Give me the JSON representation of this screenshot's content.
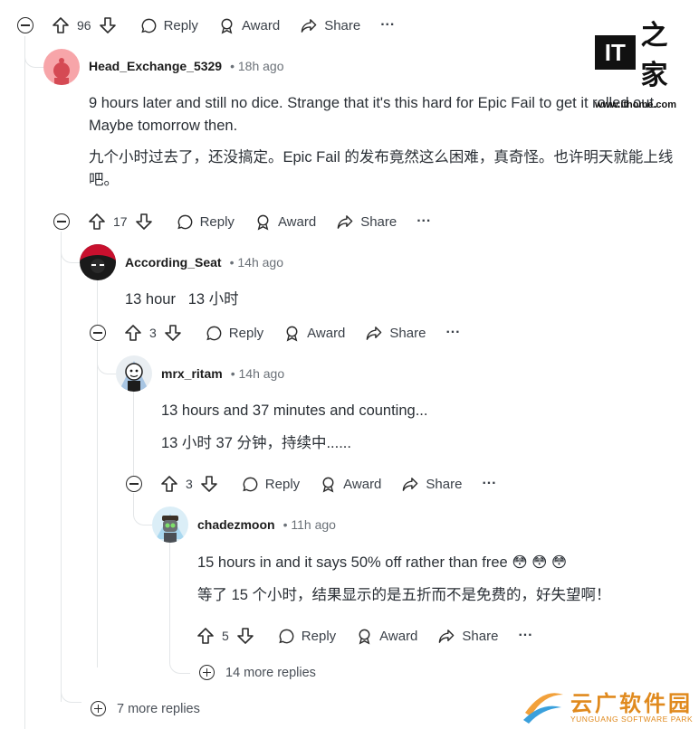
{
  "actions": {
    "reply": "Reply",
    "award": "Award",
    "share": "Share",
    "more": "···"
  },
  "top": {
    "votes": "96"
  },
  "comments": [
    {
      "user": "Head_Exchange_5329",
      "time": "18h ago",
      "votes": "17",
      "lines": [
        "9 hours later and still no dice. Strange that it's this hard for Epic Fail to get it rolled out. Maybe tomorrow then.",
        "九个小时过去了，还没搞定。Epic Fail 的发布竟然这么困难，真奇怪。也许明天就能上线吧。"
      ]
    },
    {
      "user": "According_Seat",
      "time": "14h ago",
      "votes": "3",
      "lines": [
        "13 hour   13 小时"
      ]
    },
    {
      "user": "mrx_ritam",
      "time": "14h ago",
      "votes": "3",
      "lines": [
        "13 hours and 37 minutes and counting...",
        "13 小时 37 分钟，持续中......"
      ]
    },
    {
      "user": "chadezmoon",
      "time": "11h ago",
      "votes": "5",
      "lines": [
        "15 hours in and it says 50% off rather than free 😳 😳 😳",
        "等了 15 个小时，结果显示的是五折而不是免费的，好失望啊！"
      ]
    }
  ],
  "more_replies": [
    "14 more replies",
    "7 more replies"
  ],
  "watermarks": {
    "ithome": "www.ithome.com",
    "yg_cn": "云广软件园",
    "yg_en": "YUNGUANG SOFTWARE PARK"
  }
}
